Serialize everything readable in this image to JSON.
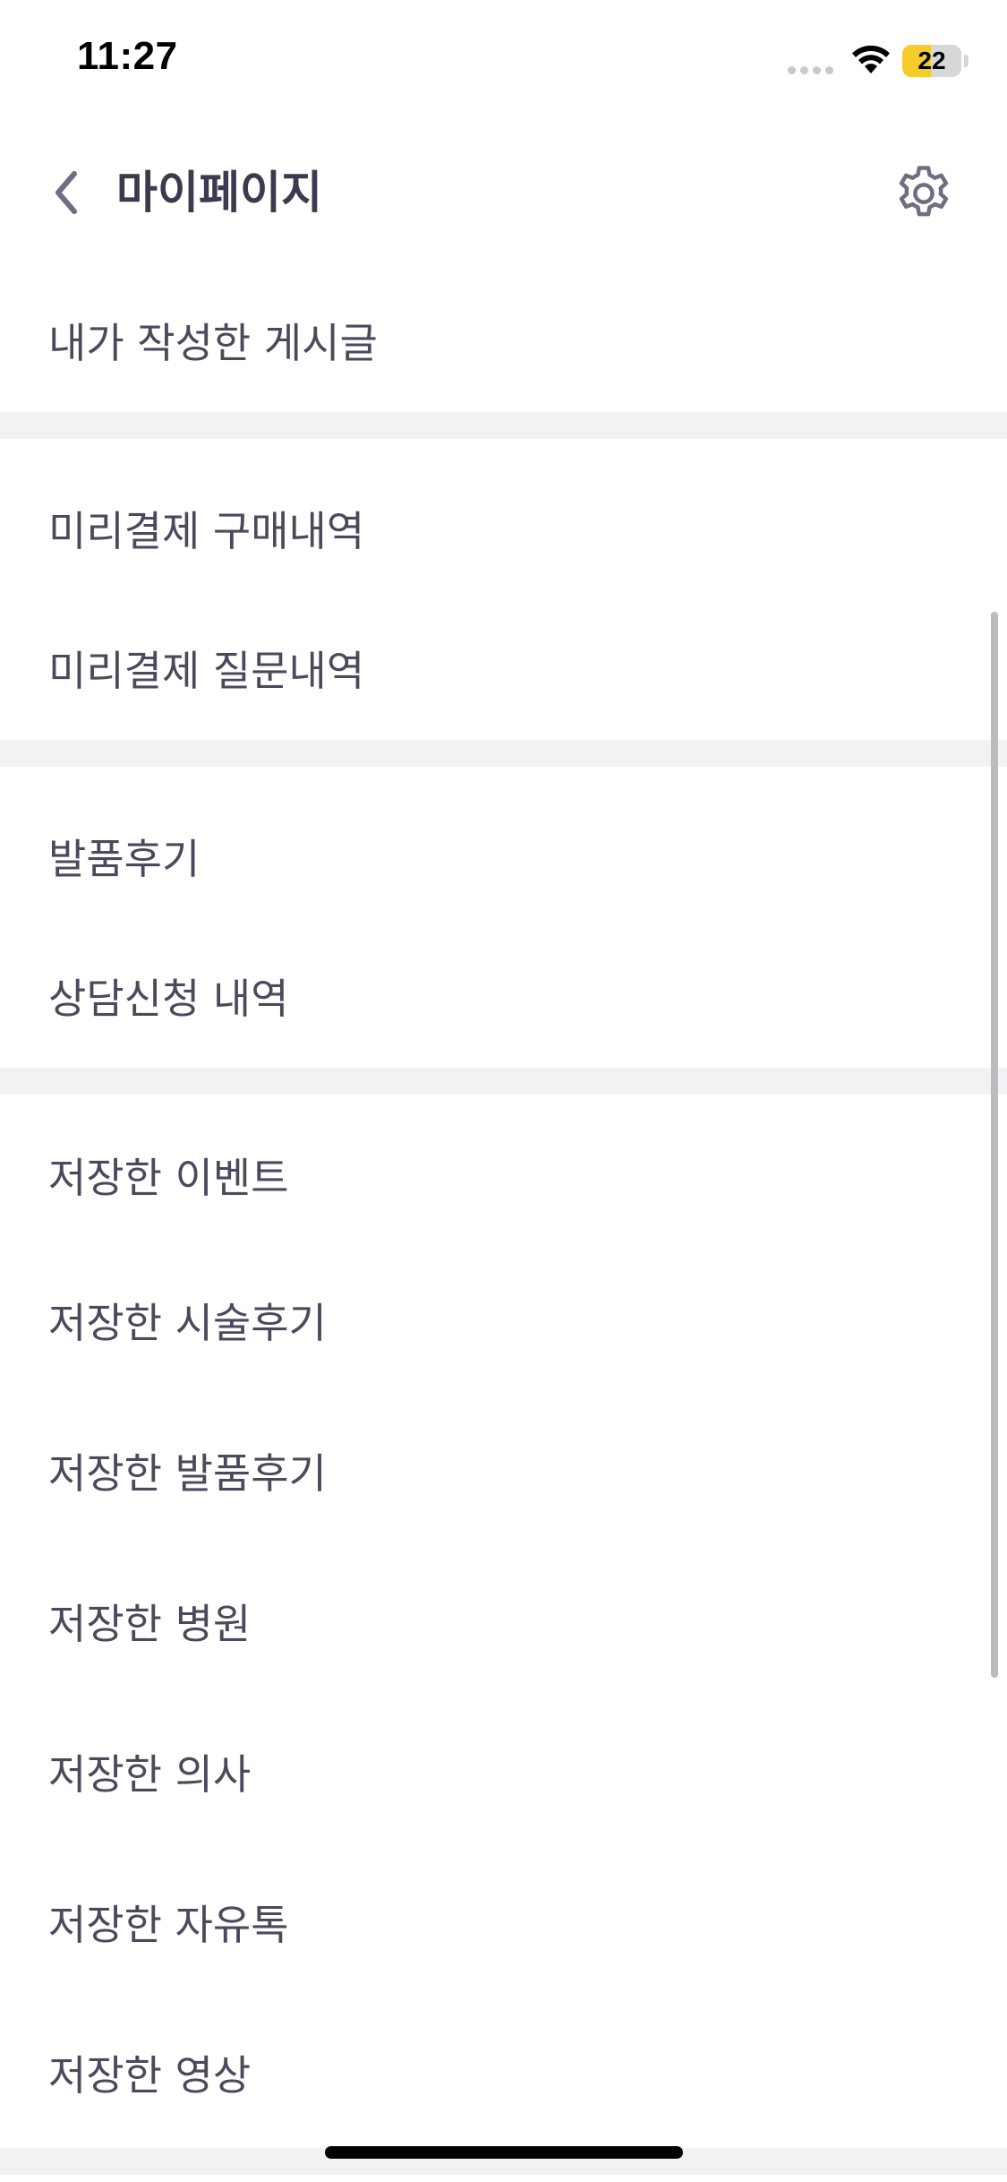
{
  "status_bar": {
    "time": "11:27",
    "battery_level": "22",
    "battery_fraction": 0.22,
    "battery_color": "#f6cc2a"
  },
  "header": {
    "title": "마이페이지",
    "back_icon": "chevron-left-icon",
    "settings_icon": "gear-icon"
  },
  "menu_groups": [
    {
      "items": [
        {
          "label": "내가 작성한 게시글"
        }
      ]
    },
    {
      "items": [
        {
          "label": "미리결제 구매내역"
        },
        {
          "label": "미리결제 질문내역"
        }
      ]
    },
    {
      "items": [
        {
          "label": "발품후기"
        },
        {
          "label": "상담신청 내역"
        }
      ]
    },
    {
      "items": [
        {
          "label": "저장한 이벤트"
        },
        {
          "label": "저장한 시술후기"
        },
        {
          "label": "저장한 발품후기"
        },
        {
          "label": "저장한 병원"
        },
        {
          "label": "저장한 의사"
        },
        {
          "label": "저장한 자유톡"
        },
        {
          "label": "저장한 영상"
        }
      ]
    }
  ],
  "colors": {
    "text": "#4a4a5c",
    "title": "#3b3a4e",
    "divider": "#f2f2f4",
    "icon": "#6f6e80"
  }
}
